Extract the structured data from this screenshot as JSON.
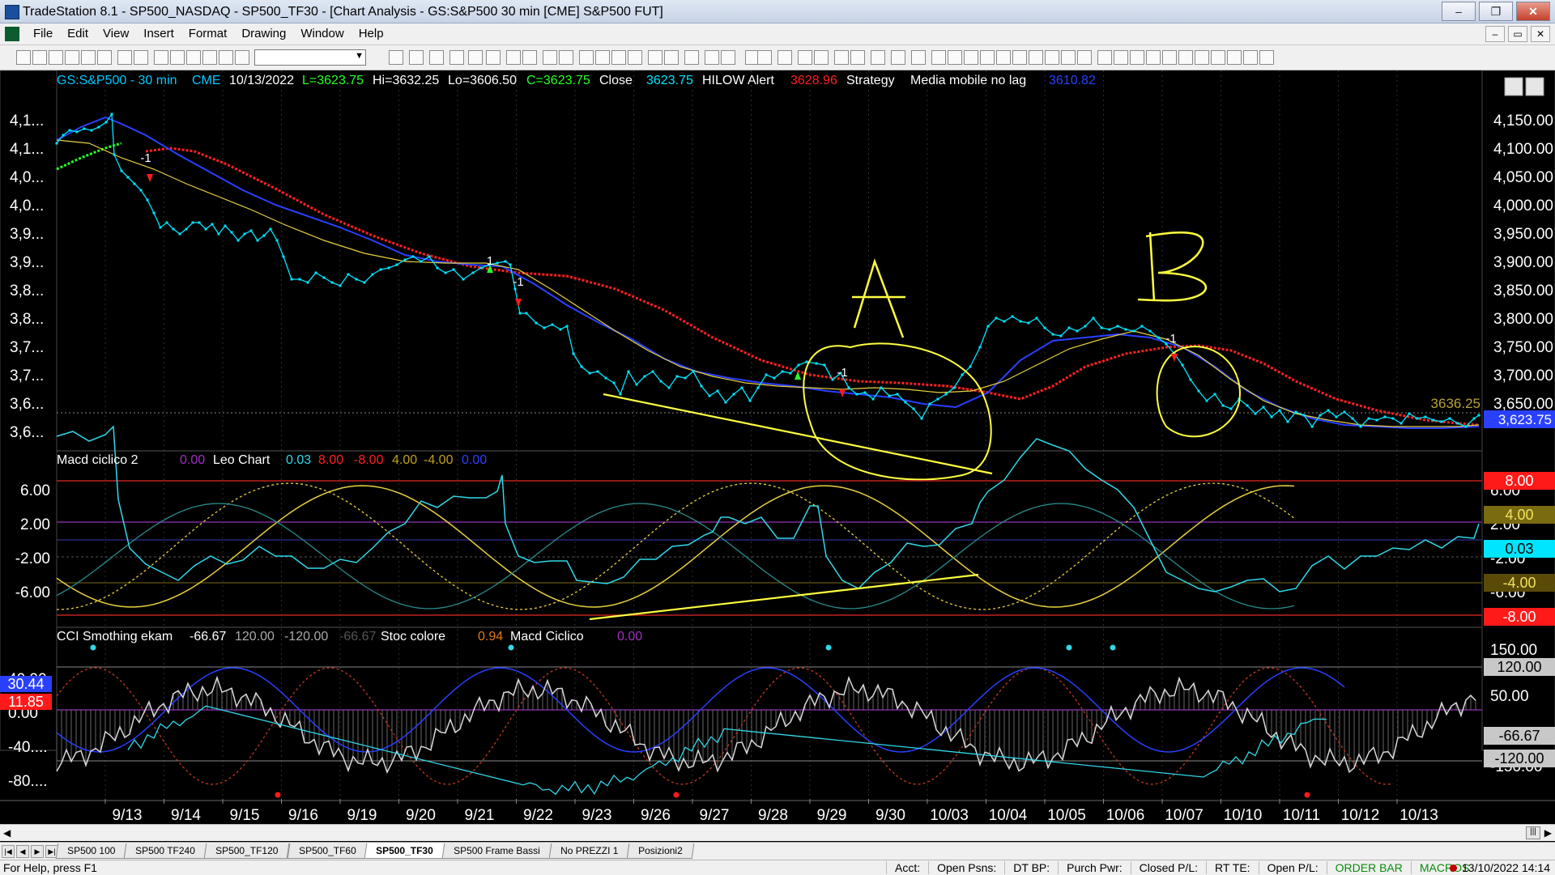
{
  "window": {
    "title": "TradeStation 8.1 - SP500_NASDAQ - SP500_TF30 - [Chart Analysis - GS:S&P500  30 min  [CME] S&P500 FUT]",
    "controls": [
      "‒",
      "❐",
      "✕"
    ]
  },
  "menu": [
    "File",
    "Edit",
    "View",
    "Insert",
    "Format",
    "Drawing",
    "Window",
    "Help"
  ],
  "mdi_controls": [
    "–",
    "▭",
    "✕"
  ],
  "price_panel": {
    "symbol": "GS:S&P500 - 30 min",
    "exchange": "CME",
    "date": "10/13/2022",
    "last": "L=3623.75",
    "high": "Hi=3632.25",
    "low": "Lo=3606.50",
    "close": "C=3623.75",
    "close_label": "Close",
    "close_value": "3623.75",
    "hilow_label": "HILOW Alert",
    "hilow_value": "3628.96",
    "strategy_label": "Strategy",
    "ma_label": "Media mobile no lag",
    "ma_value": "3610.82",
    "axis_right": [
      "4,150.00",
      "4,100.00",
      "4,050.00",
      "4,000.00",
      "3,950.00",
      "3,900.00",
      "3,850.00",
      "3,800.00",
      "3,750.00",
      "3,700.00",
      "3,650.00"
    ],
    "axis_left": [
      "4,1...",
      "4,1...",
      "4,0...",
      "4,0...",
      "3,9...",
      "3,9...",
      "3,8...",
      "3,8...",
      "3,7...",
      "3,7...",
      "3,6...",
      "3,6..."
    ],
    "ref_line_label": "3636.25",
    "last_price_label": "3,623.75",
    "annotation_a": "A",
    "annotation_b": "B",
    "signal_labels": [
      "-1",
      "1",
      "-1",
      "-1",
      "-1"
    ]
  },
  "macd_panel": {
    "title": "Macd ciclico 2",
    "v1": "0.00",
    "leo_label": "Leo Chart",
    "v2": "0.03",
    "v3": "8.00",
    "v4": "-8.00",
    "v5": "4.00",
    "v6": "-4.00",
    "v7": "0.00",
    "axis_left": [
      "6.00",
      "2.00",
      "-2.00",
      "-6.00"
    ],
    "axis_right": [
      "6.00",
      "2.00",
      "-2.00",
      "-6.00"
    ],
    "tags": [
      "8.00",
      "4.00",
      "0.03",
      "-4.00",
      "-8.00"
    ]
  },
  "cci_panel": {
    "title": "CCI Smothing ekam",
    "v1": "-66.67",
    "v2": "120.00",
    "v3": "-120.00",
    "v4": "-66.67",
    "stoc_label": "Stoc colore",
    "v5": "0.94",
    "macd_label": "Macd Ciclico",
    "v6": "0.00",
    "axis_left": [
      "40.00",
      "0.00",
      "-40....",
      "-80...."
    ],
    "left_tags": [
      "30.44",
      "11.85"
    ],
    "axis_right": [
      "150.00",
      "50.00",
      "-150.00"
    ],
    "tags": [
      "120.00",
      "-66.67",
      "-120.00"
    ]
  },
  "time_axis": [
    "9/13",
    "9/14",
    "9/15",
    "9/16",
    "9/19",
    "9/20",
    "9/21",
    "9/22",
    "9/23",
    "9/26",
    "9/27",
    "9/28",
    "9/29",
    "9/30",
    "10/03",
    "10/04",
    "10/05",
    "10/06",
    "10/07",
    "10/10",
    "10/11",
    "10/12",
    "10/13"
  ],
  "tabs": [
    "SP500 100",
    "SP500 TF240",
    "SP500_TF120",
    "SP500_TF60",
    "SP500_TF30",
    "SP500 Frame Bassi",
    "No PREZZI 1",
    "Posizioni2"
  ],
  "active_tab": "SP500_TF30",
  "status": {
    "help": "For Help, press F1",
    "fields": [
      "Acct:",
      "Open Psns:",
      "DT BP:",
      "Purch Pwr:",
      "Closed P/L:",
      "RT TE:",
      "Open P/L:"
    ],
    "order_bar": "ORDER BAR",
    "macros": "MACROS",
    "clock": "13/10/2022 14:14"
  },
  "colors": {
    "cyan": "#00e5ff",
    "red_ma": "#ff2020",
    "blue_ma": "#2040ff",
    "green_ma": "#20e020",
    "yellow": "#ffff40"
  }
}
